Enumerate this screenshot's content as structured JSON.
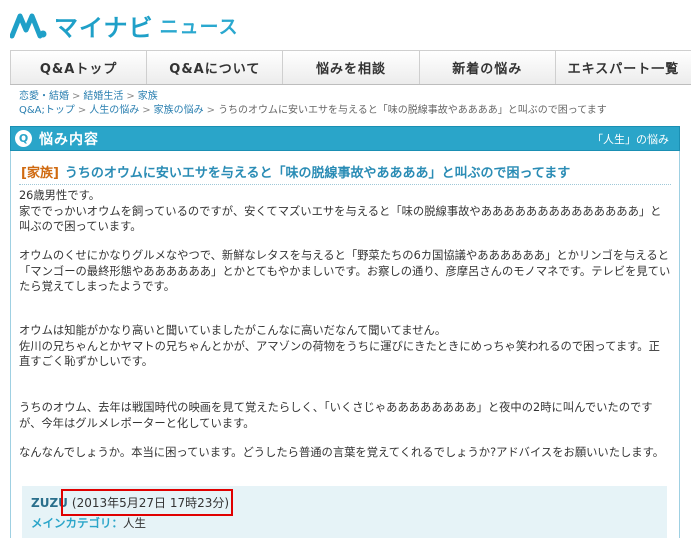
{
  "header": {
    "logo_text": "マイナビ",
    "logo_sub": "ニュース",
    "logo_color": "#1fa0c8"
  },
  "nav": {
    "items": [
      {
        "label": "Q&Aトップ"
      },
      {
        "label": "Q&Aについて"
      },
      {
        "label": "悩みを相談"
      },
      {
        "label": "新着の悩み"
      },
      {
        "label": "エキスパート一覧"
      }
    ]
  },
  "breadcrumb1": {
    "items": [
      "恋愛・結婚",
      "結婚生活",
      "家族"
    ],
    "sep": ">"
  },
  "breadcrumb2": {
    "items": [
      "Q&A;トップ",
      "人生の悩み",
      "家族の悩み",
      "うちのオウムに安いエサを与えると「味の脱線事故やああああ」と叫ぶので困ってます"
    ],
    "sep": ">"
  },
  "section": {
    "badge": "Q",
    "title": "悩み内容",
    "category_link": "「人生」の悩み",
    "accent_color": "#2aa5c9"
  },
  "question": {
    "tag": "[家族]",
    "title": "うちのオウムに安いエサを与えると「味の脱線事故やああああ」と叫ぶので困ってます",
    "paragraphs": [
      "26歳男性です。\n家ででっかいオウムを飼っているのですが、安くてマズいエサを与えると「味の脱線事故やああああああああああああああ」と叫ぶので困っています。",
      "オウムのくせにかなりグルメなやつで、新鮮なレタスを与えると「野菜たちの6カ国協議やああああああ」とかリンゴを与えると「マンゴーの最終形態やああああああ」とかとてもやかましいです。お察しの通り、彦摩呂さんのモノマネです。テレビを見ていたら覚えてしまったようです。",
      "オウムは知能がかなり高いと聞いていましたがこんなに高いだなんて聞いてません。\n佐川の兄ちゃんとかヤマトの兄ちゃんとかが、アマゾンの荷物をうちに運びにきたときにめっちゃ笑われるので困ってます。正直すごく恥ずかしいです。",
      "うちのオウム、去年は戦国時代の映画を見て覚えたらしく、「いくさじゃああああああああ」と夜中の2時に叫んでいたのですが、今年はグルメレポーターと化しています。",
      "なんなんでしょうか。本当に困っています。どうしたら普通の言葉を覚えてくれるでしょうか?アドバイスをお願いいたします。"
    ]
  },
  "author": {
    "name": "ZUZU",
    "date": "(2013年5月27日 17時23分)",
    "category_label": "メインカテゴリ：",
    "category_value": "人生",
    "highlight_color": "#e00000"
  }
}
